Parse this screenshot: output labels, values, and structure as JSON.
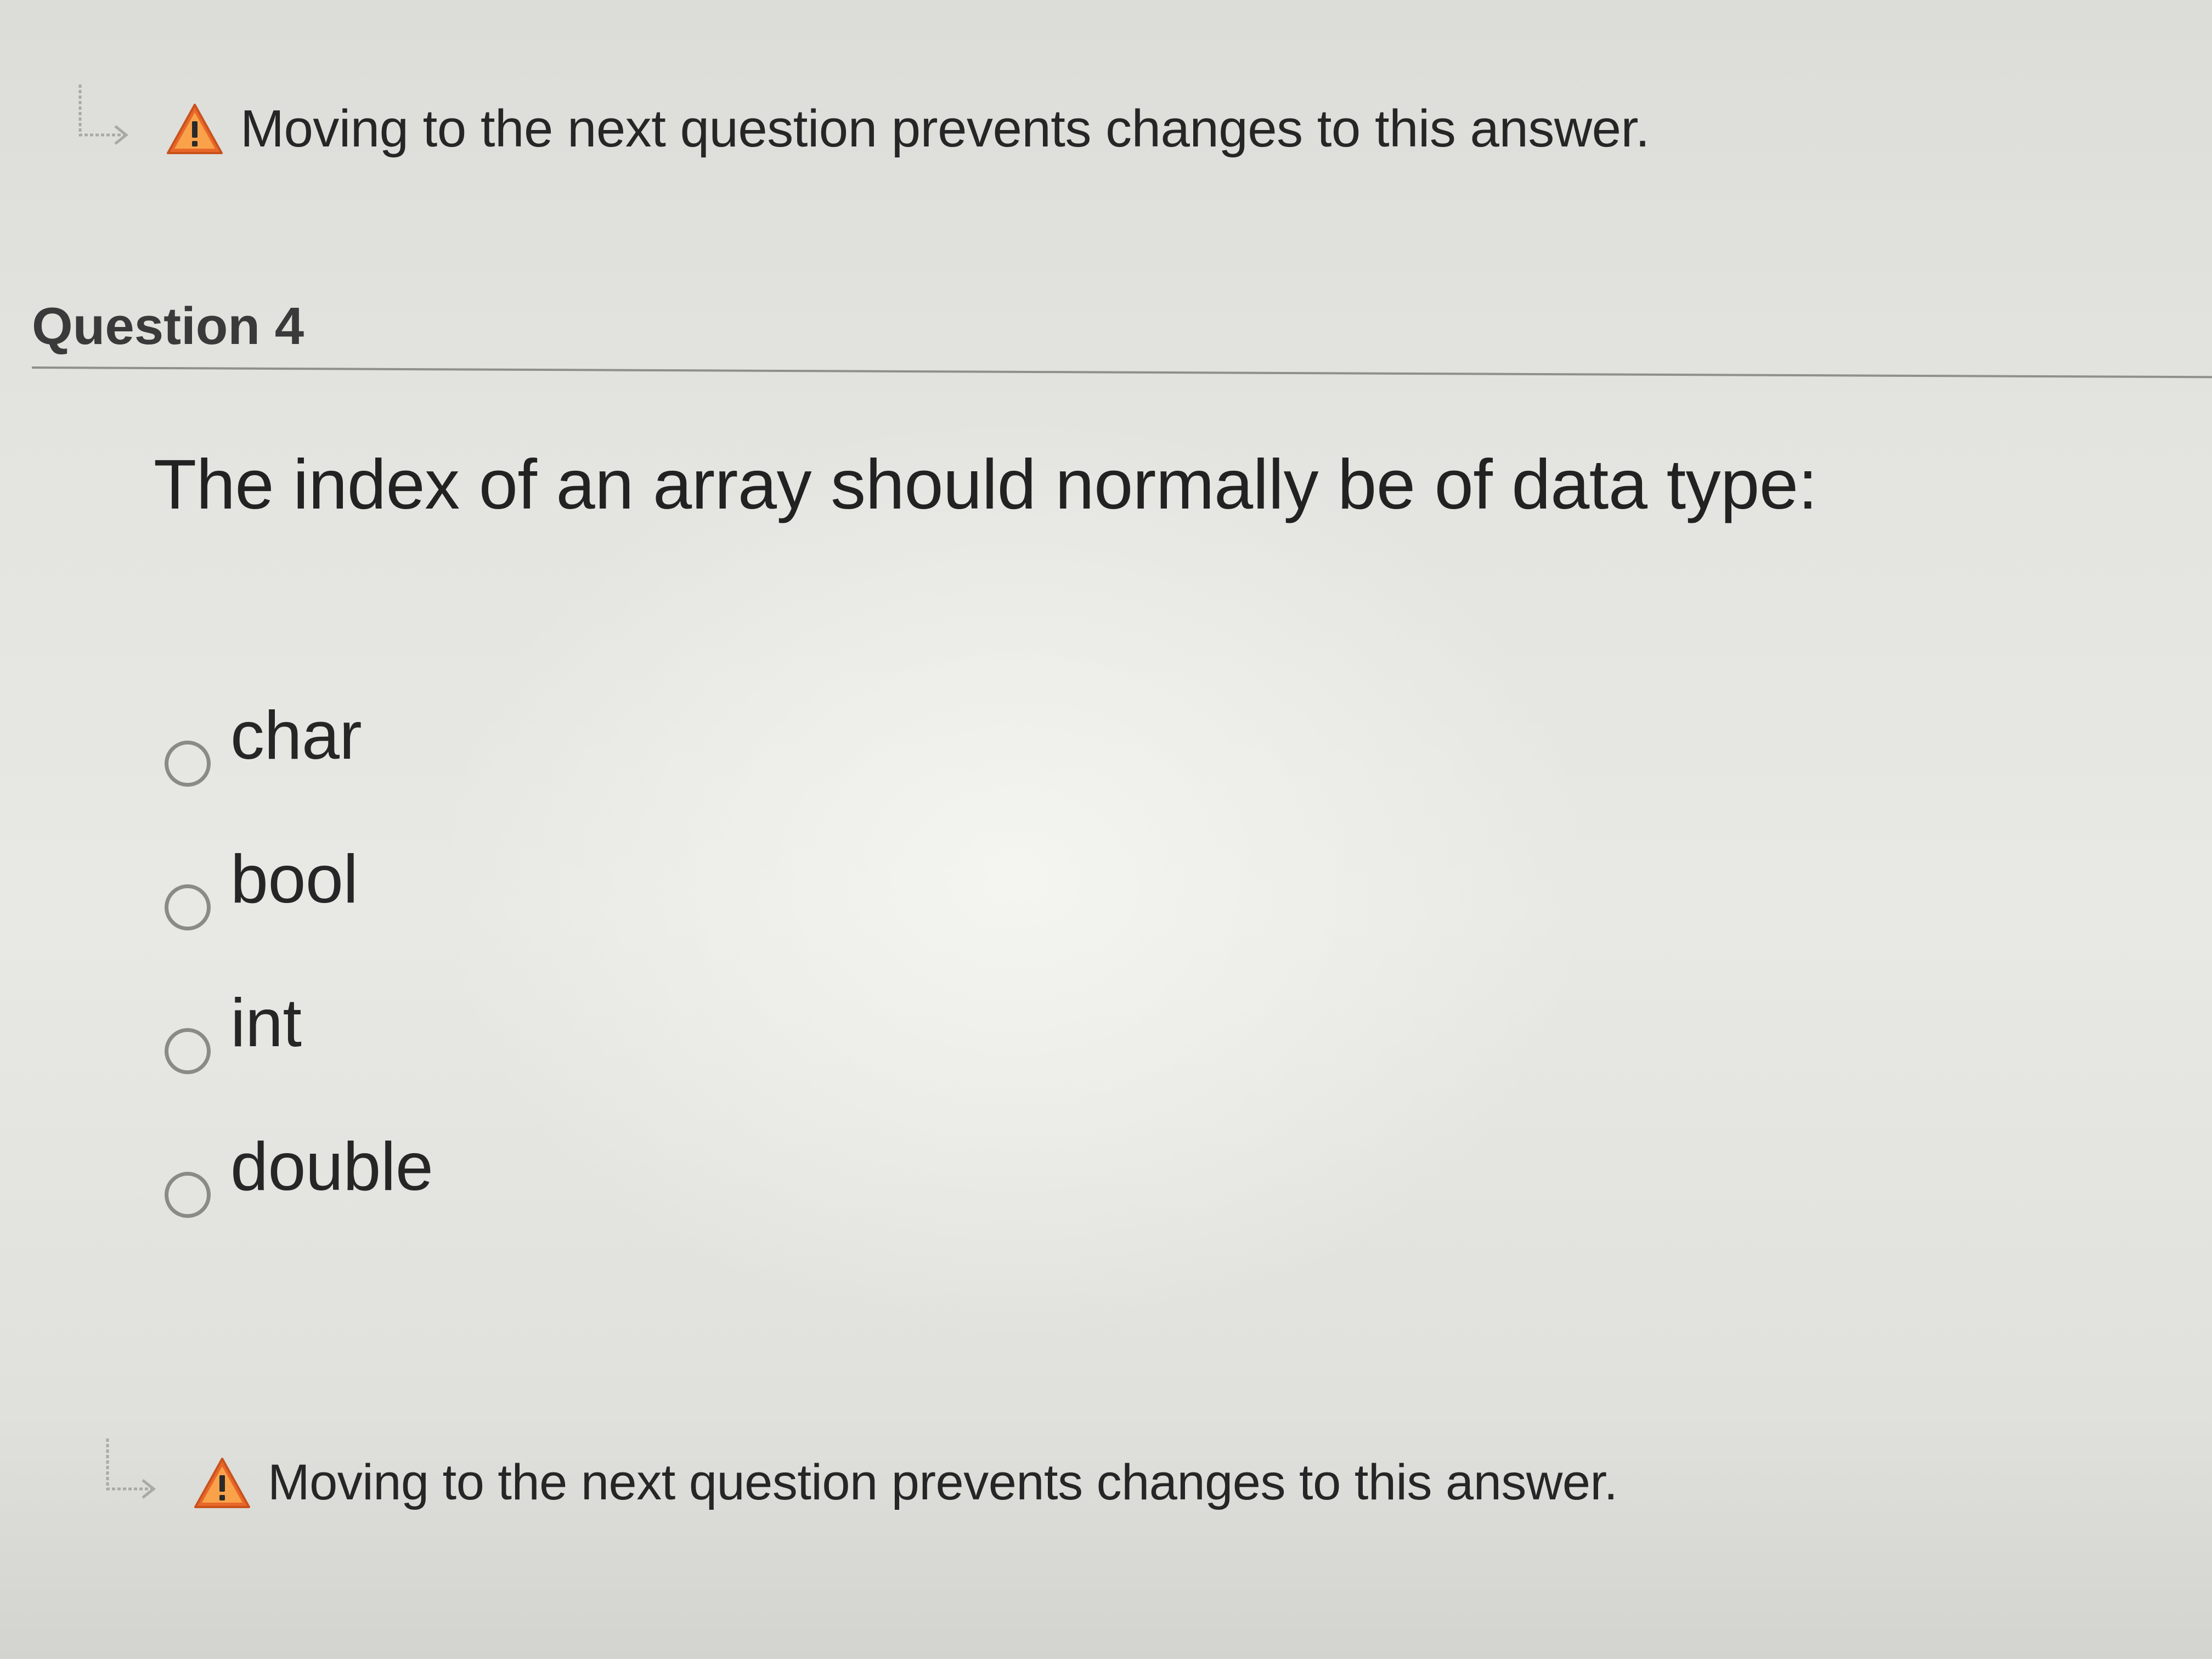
{
  "warning": {
    "icon": "warning-triangle-icon",
    "text": "Moving to the next question prevents changes to this answer.",
    "color": "#e8672a"
  },
  "question": {
    "title": "Question 4",
    "prompt": "The index of an array should normally be of data type:",
    "options": [
      {
        "label": "char",
        "selected": false
      },
      {
        "label": "bool",
        "selected": false
      },
      {
        "label": "int",
        "selected": false
      },
      {
        "label": "double",
        "selected": false
      }
    ]
  }
}
